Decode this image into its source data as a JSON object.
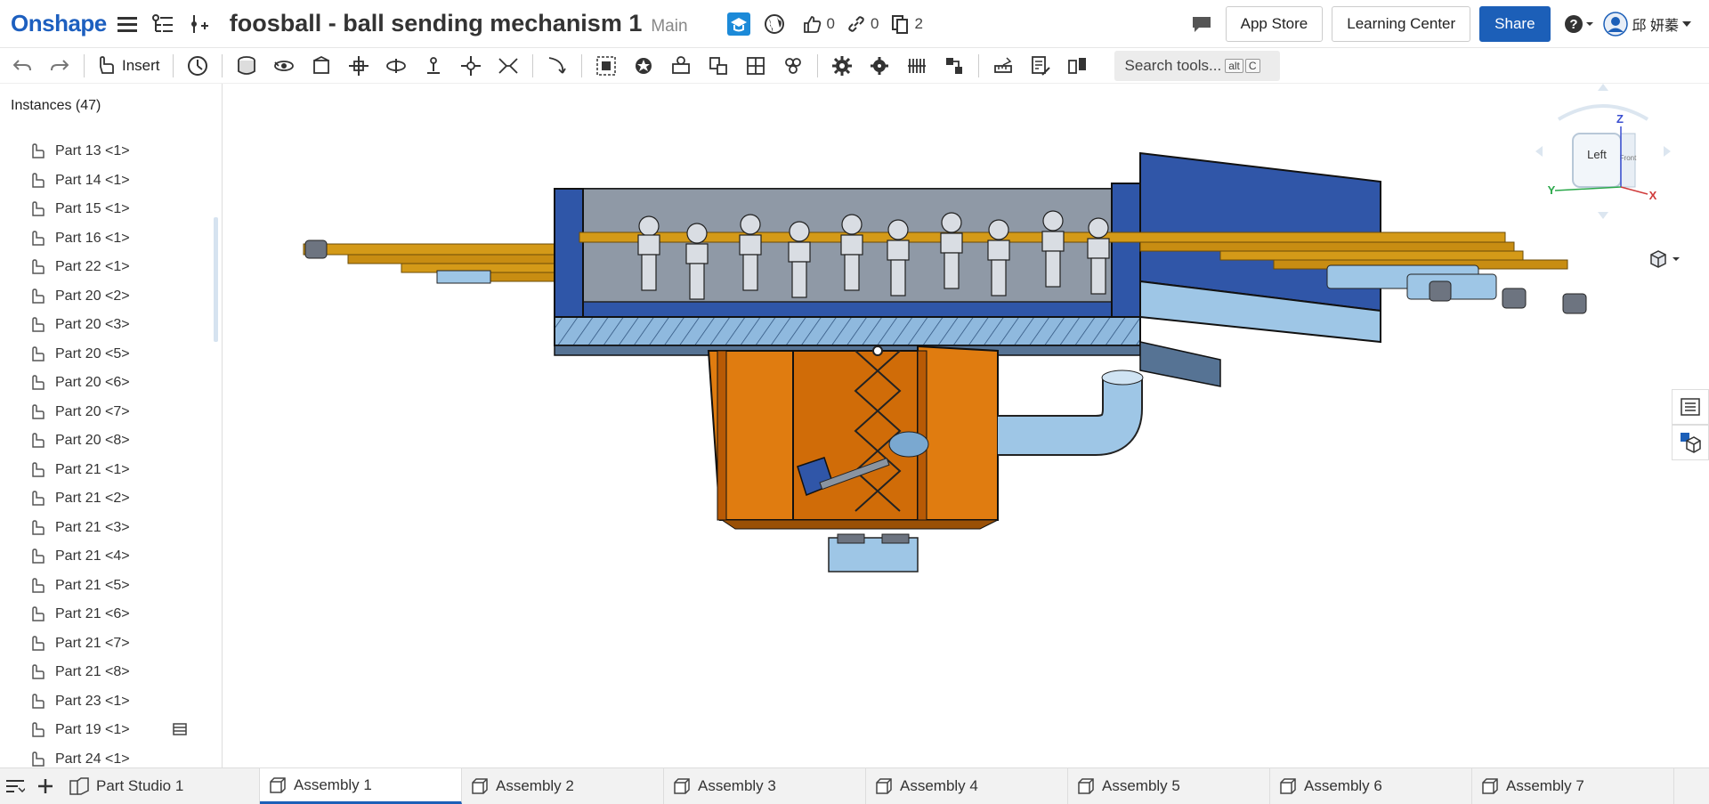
{
  "app": {
    "logo": "Onshape"
  },
  "document": {
    "title": "foosball - ball sending mechanism 1",
    "branch": "Main"
  },
  "counts": {
    "likes": "0",
    "links": "0",
    "copies": "2"
  },
  "header": {
    "app_store": "App Store",
    "learning_center": "Learning Center",
    "share": "Share",
    "user_name": "邱 妍蓁"
  },
  "toolbar": {
    "insert": "Insert",
    "search_placeholder": "Search tools...",
    "search_key1": "alt",
    "search_key2": "C"
  },
  "panel": {
    "title": "Instances (47)",
    "items": [
      "Part 13 <1>",
      "Part 14 <1>",
      "Part 15 <1>",
      "Part 16 <1>",
      "Part 22 <1>",
      "Part 20 <2>",
      "Part 20 <3>",
      "Part 20 <5>",
      "Part 20 <6>",
      "Part 20 <7>",
      "Part 20 <8>",
      "Part 21 <1>",
      "Part 21 <2>",
      "Part 21 <3>",
      "Part 21 <4>",
      "Part 21 <5>",
      "Part 21 <6>",
      "Part 21 <7>",
      "Part 21 <8>",
      "Part 23 <1>",
      "Part 19 <1>",
      "Part 24 <1>"
    ]
  },
  "viewcube": {
    "face_left": "Left",
    "face_front": "Front",
    "axis_z": "Z",
    "axis_y": "Y",
    "axis_x": "X"
  },
  "tabs": [
    "Part Studio 1",
    "Assembly 1",
    "Assembly 2",
    "Assembly 3",
    "Assembly 4",
    "Assembly 5",
    "Assembly 6",
    "Assembly 7"
  ],
  "colors": {
    "brand": "#1c5fb8",
    "table_blue": "#2f56a8",
    "orange": "#e07c10",
    "rod": "#d49a18",
    "light_blue": "#9fc6e4"
  }
}
